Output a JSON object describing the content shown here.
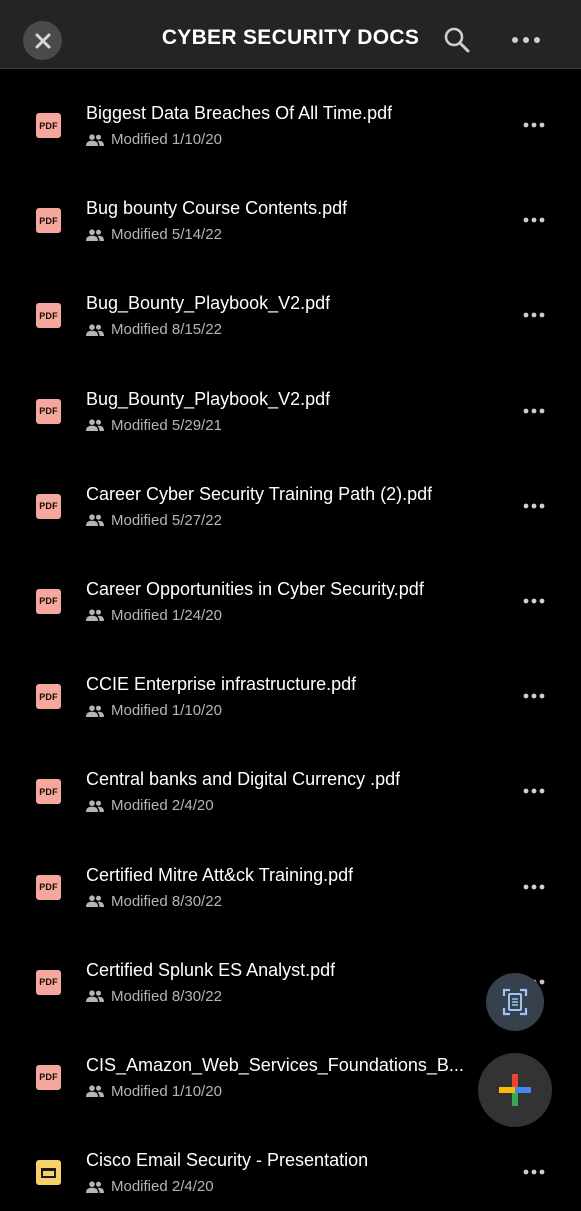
{
  "header": {
    "title": "CYBER SECURITY DOCS",
    "close_icon": "close-icon",
    "search_icon": "search-icon",
    "more_icon": "more-horizontal-icon"
  },
  "files": [
    {
      "name": "Biggest Data Breaches Of All Time.pdf",
      "modified": "Modified 1/10/20",
      "type": "pdf",
      "type_label": "PDF"
    },
    {
      "name": "Bug bounty Course Contents.pdf",
      "modified": "Modified 5/14/22",
      "type": "pdf",
      "type_label": "PDF"
    },
    {
      "name": "Bug_Bounty_Playbook_V2.pdf",
      "modified": "Modified 8/15/22",
      "type": "pdf",
      "type_label": "PDF"
    },
    {
      "name": "Bug_Bounty_Playbook_V2.pdf",
      "modified": "Modified 5/29/21",
      "type": "pdf",
      "type_label": "PDF"
    },
    {
      "name": "Career Cyber Security Training Path (2).pdf",
      "modified": "Modified 5/27/22",
      "type": "pdf",
      "type_label": "PDF"
    },
    {
      "name": "Career Opportunities in Cyber Security.pdf",
      "modified": "Modified 1/24/20",
      "type": "pdf",
      "type_label": "PDF"
    },
    {
      "name": "CCIE Enterprise infrastructure.pdf",
      "modified": "Modified 1/10/20",
      "type": "pdf",
      "type_label": "PDF"
    },
    {
      "name": "Central banks and Digital Currency .pdf",
      "modified": "Modified 2/4/20",
      "type": "pdf",
      "type_label": "PDF"
    },
    {
      "name": "Certified Mitre Att&ck Training.pdf",
      "modified": "Modified 8/30/22",
      "type": "pdf",
      "type_label": "PDF"
    },
    {
      "name": "Certified Splunk ES Analyst.pdf",
      "modified": "Modified 8/30/22",
      "type": "pdf",
      "type_label": "PDF"
    },
    {
      "name": "CIS_Amazon_Web_Services_Foundations_B...",
      "modified": "Modified 1/10/20",
      "type": "pdf",
      "type_label": "PDF"
    },
    {
      "name": "Cisco Email Security  - Presentation",
      "modified": "Modified 2/4/20",
      "type": "slides",
      "type_label": ""
    }
  ],
  "fabs": {
    "scan_icon": "document-scan-icon",
    "add_icon": "plus-icon"
  },
  "colors": {
    "background": "#000000",
    "header": "#242424",
    "pdf_icon": "#f5a69d",
    "slides_icon": "#f6d168",
    "meta_text": "#b5b5b5",
    "plus_blue": "#4285f4",
    "plus_red": "#ea4335",
    "plus_yellow": "#fbbc04",
    "plus_green": "#34a853"
  }
}
